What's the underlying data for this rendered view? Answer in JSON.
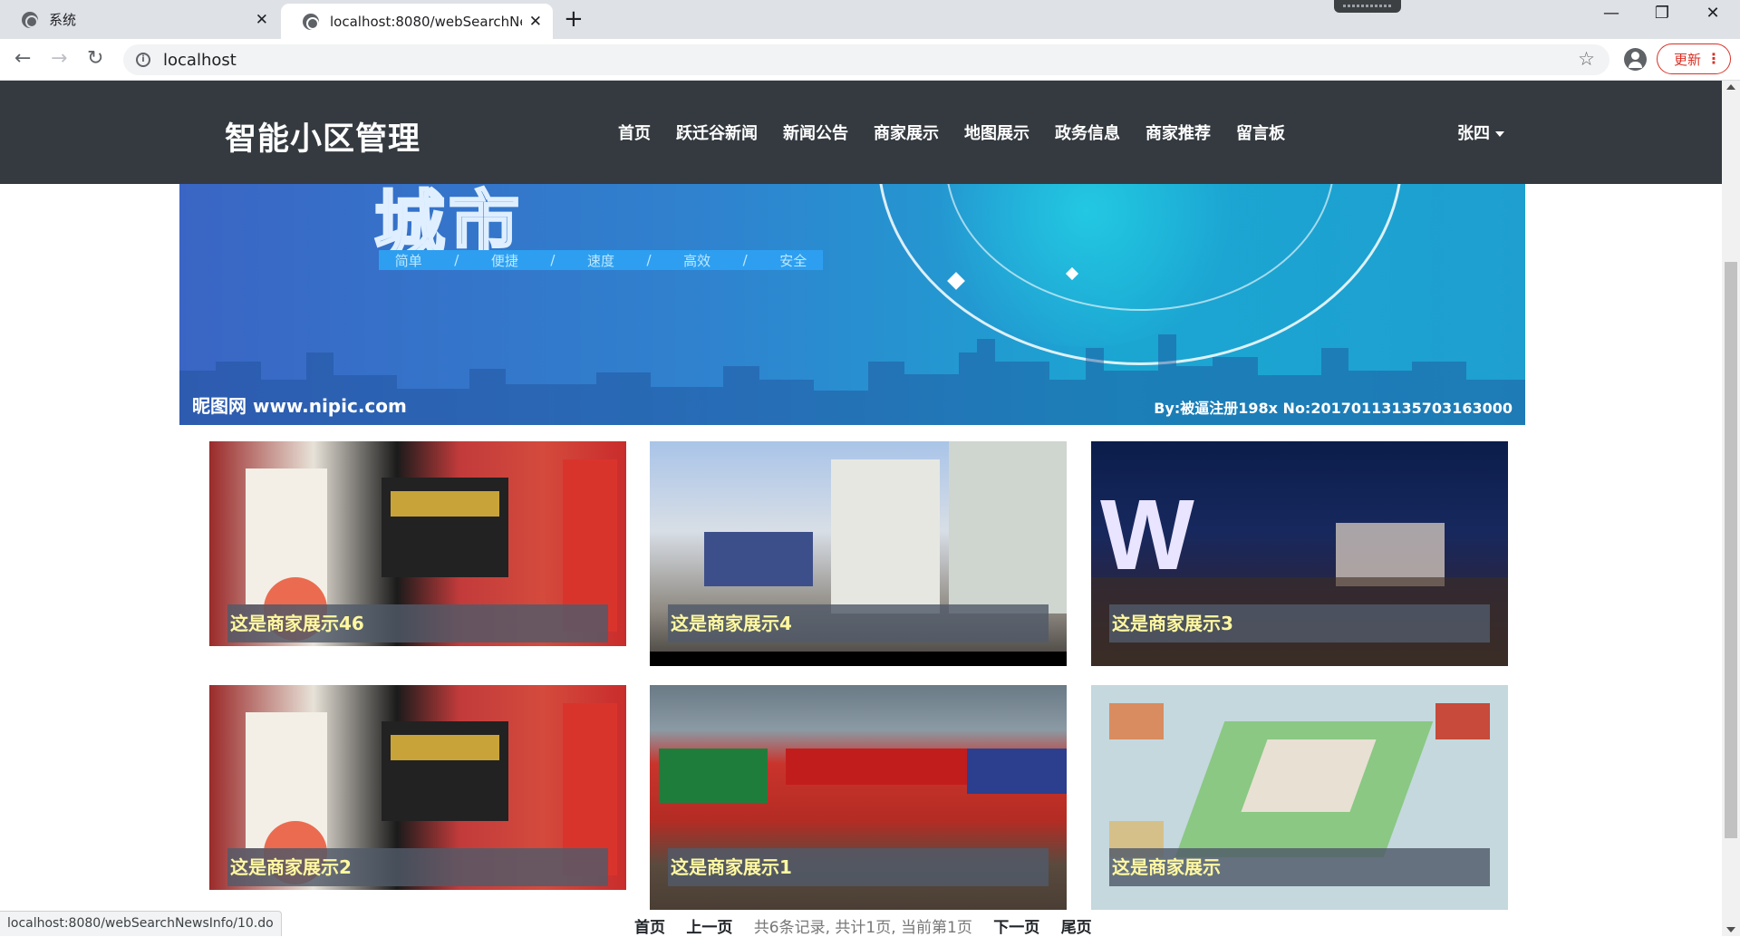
{
  "browser": {
    "tabs": [
      {
        "title": "系统"
      },
      {
        "title": "localhost:8080/webSearchNew"
      }
    ],
    "url": "localhost",
    "update_label": "更新",
    "status_url": "localhost:8080/webSearchNewsInfo/10.do"
  },
  "site": {
    "brand": "智能小区管理",
    "menu": [
      "首页",
      "跃迁谷新闻",
      "新闻公告",
      "商家展示",
      "地图展示",
      "政务信息",
      "商家推荐",
      "留言板"
    ],
    "user": "张四"
  },
  "banner": {
    "big_text": "城市",
    "tags": [
      "简单",
      "/",
      "便捷",
      "/",
      "速度",
      "/",
      "高效",
      "/",
      "安全"
    ],
    "watermark_left": "昵图网 www.nipic.com",
    "watermark_right": "By:被逼注册198x No:20170113135703163000"
  },
  "cards": [
    {
      "caption": "这是商家展示46"
    },
    {
      "caption": "这是商家展示4"
    },
    {
      "caption": "这是商家展示3"
    },
    {
      "caption": "这是商家展示2"
    },
    {
      "caption": "这是商家展示1"
    },
    {
      "caption": "这是商家展示"
    }
  ],
  "pager": {
    "first": "首页",
    "prev": "上一页",
    "info": "共6条记录, 共计1页, 当前第1页",
    "next": "下一页",
    "last": "尾页"
  }
}
